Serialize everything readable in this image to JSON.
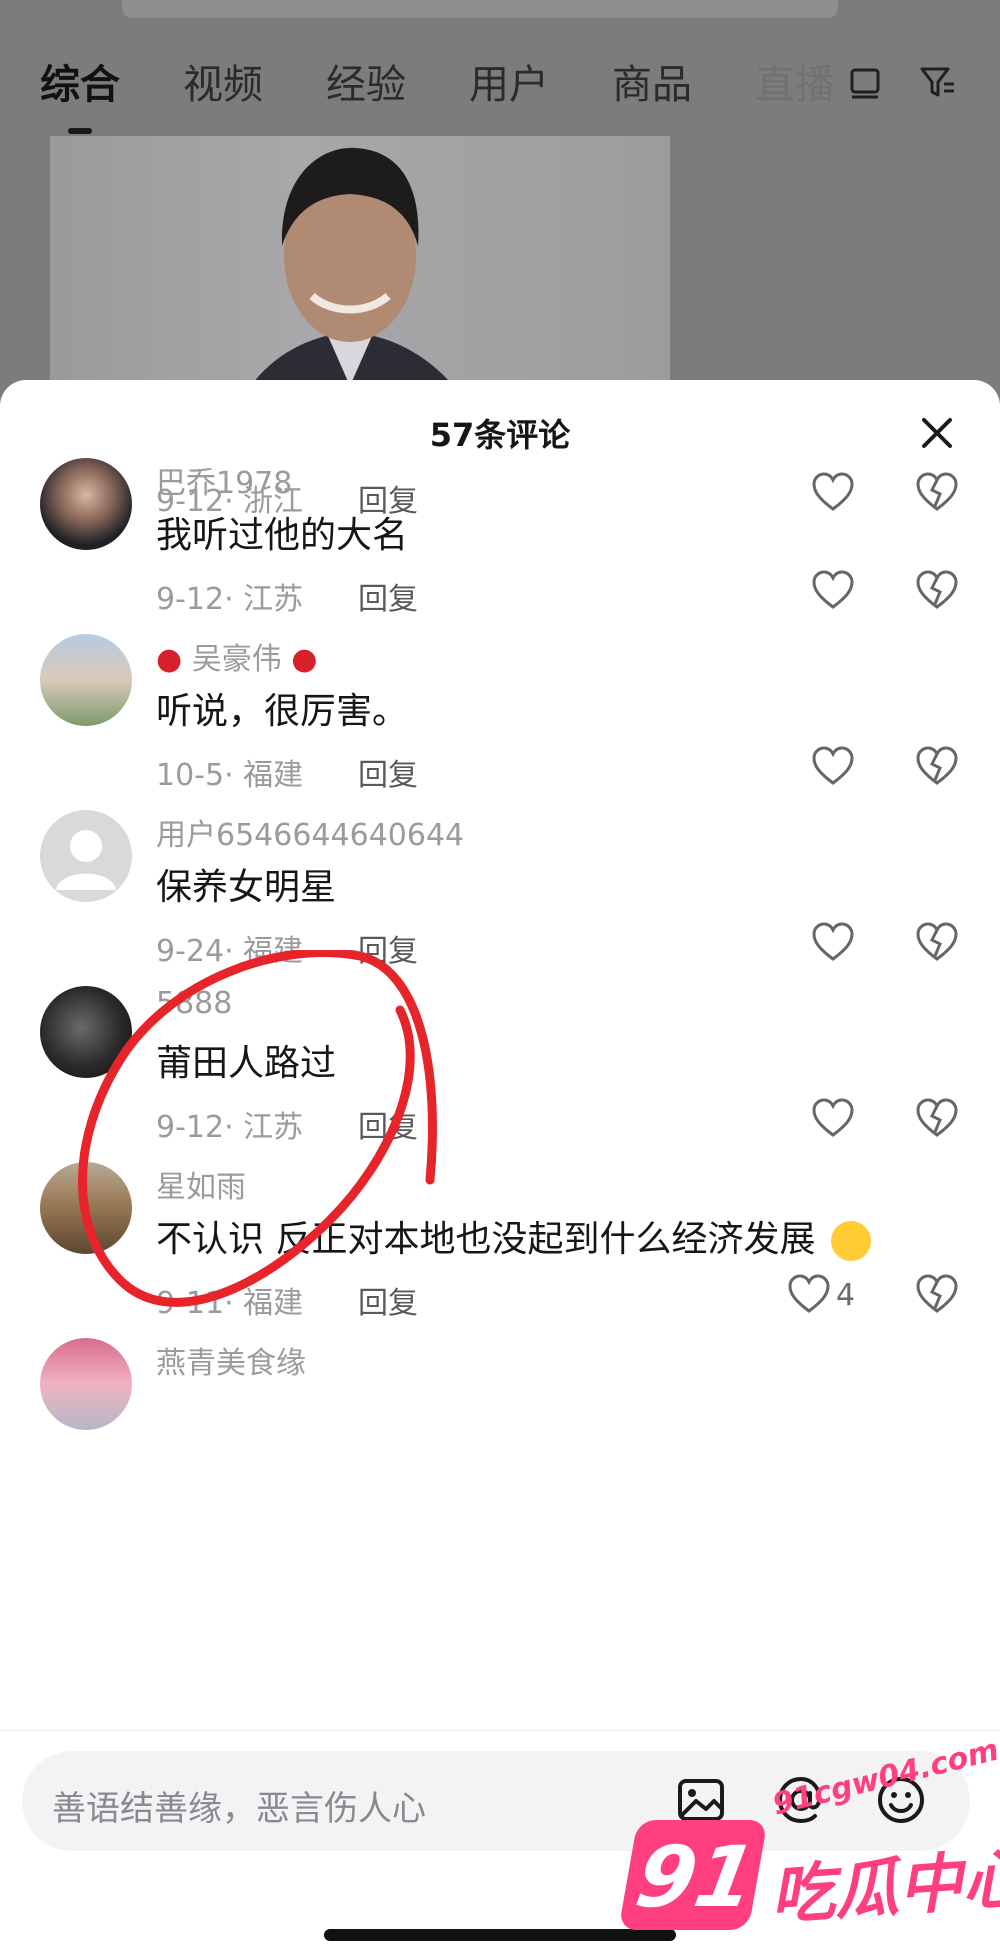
{
  "search_tabs": {
    "items": [
      "综合",
      "视频",
      "经验",
      "用户",
      "商品",
      "直播"
    ],
    "active_index": 0
  },
  "sheet": {
    "title": "57条评论"
  },
  "comments": [
    {
      "name": "",
      "text": "",
      "date_location": "9-12· 浙江",
      "reply_label": "回复",
      "like_count": ""
    },
    {
      "name": "巴乔1978",
      "text": "我听过他的大名",
      "date_location": "9-12· 江苏",
      "reply_label": "回复",
      "like_count": ""
    },
    {
      "name": "吴豪伟",
      "text": "听说，很厉害。",
      "date_location": "10-5· 福建",
      "reply_label": "回复",
      "like_count": ""
    },
    {
      "name": "用户6546644640644",
      "text": "保养女明星",
      "date_location": "9-24· 福建",
      "reply_label": "回复",
      "like_count": ""
    },
    {
      "name": "5888",
      "text": "莆田人路过",
      "date_location": "9-12· 江苏",
      "reply_label": "回复",
      "like_count": ""
    },
    {
      "name": "星如雨",
      "text": "不认识 反正对本地也没起到什么经济发展",
      "date_location": "9-11· 福建",
      "reply_label": "回复",
      "like_count": "4"
    },
    {
      "name": "燕青美食缘",
      "text": "",
      "date_location": "",
      "reply_label": "",
      "like_count": ""
    }
  ],
  "input": {
    "placeholder": "善语结善缘，恶言伤人心"
  },
  "watermark": {
    "url": "91cgw04.com",
    "badge": "91",
    "text": "吃瓜中心"
  },
  "colors": {
    "annotation_red": "#e8242b",
    "watermark_pink": "#ff3f7f"
  }
}
